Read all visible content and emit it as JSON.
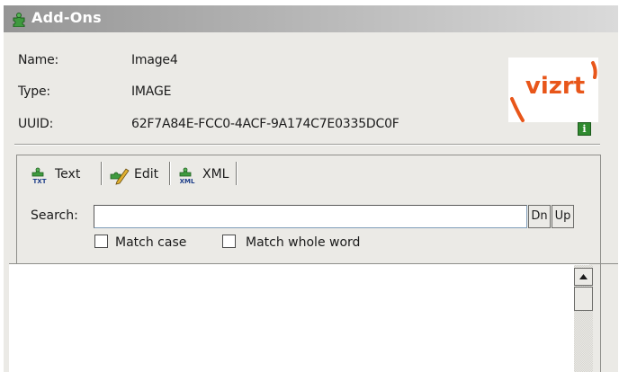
{
  "panel": {
    "title": "Add-Ons",
    "title_icon": "addon-puzzle-icon"
  },
  "info": {
    "name_label": "Name:",
    "name_value": "Image4",
    "type_label": "Type:",
    "type_value": "IMAGE",
    "uuid_label": "UUID:",
    "uuid_value": "62F7A84E-FCC0-4ACF-9A174C7E0335DC0F",
    "logo_text": "vizrt",
    "info_icon": "info-icon"
  },
  "tabs": [
    {
      "label": "Text",
      "icon": "txt-icon",
      "selected": true
    },
    {
      "label": "Edit",
      "icon": "edit-icon",
      "selected": false
    },
    {
      "label": "XML",
      "icon": "xml-icon",
      "selected": false
    }
  ],
  "search": {
    "label": "Search:",
    "value": "",
    "placeholder": "",
    "down_label": "Dn",
    "up_label": "Up"
  },
  "options": {
    "match_case_label": "Match case",
    "match_case_checked": false,
    "match_word_label": "Match whole word",
    "match_word_checked": false
  },
  "colors": {
    "logo_orange": "#e8561a",
    "accent_green": "#2f8a2f"
  }
}
